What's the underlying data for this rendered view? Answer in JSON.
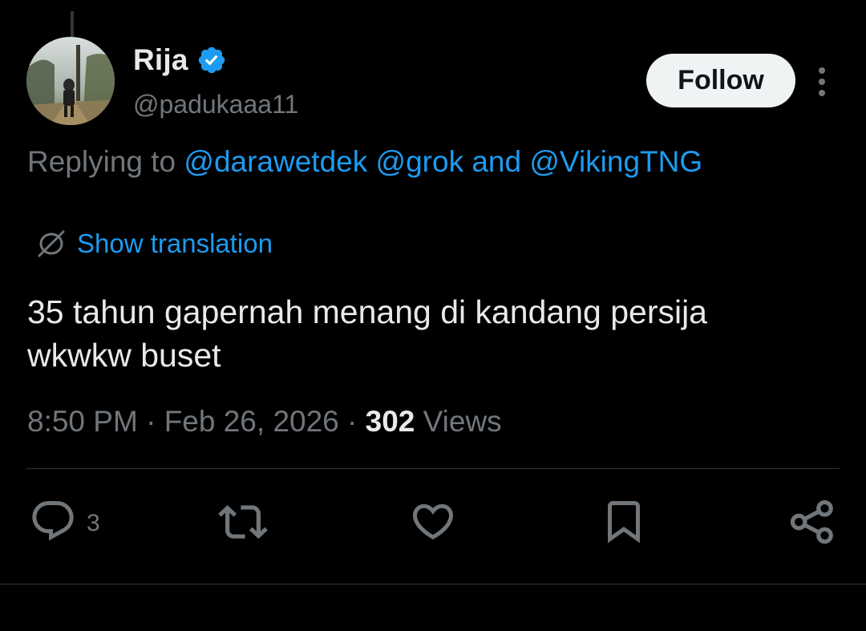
{
  "author": {
    "display_name": "Rija",
    "handle": "@padukaaa11",
    "verified": true
  },
  "follow_label": "Follow",
  "replying": {
    "prefix": "Replying to",
    "mentions": [
      "@darawetdek",
      "@grok"
    ],
    "and_word": "and",
    "last_mention": "@VikingTNG"
  },
  "translation_label": "Show translation",
  "tweet": {
    "text_line1": "35 tahun gapernah menang di kandang persija",
    "text_line2": "wkwkw buset",
    "time": "8:50 PM",
    "date": "Feb 26, 2026",
    "views_count": "302",
    "views_label": "Views"
  },
  "actions": {
    "reply_count": "3"
  },
  "colors": {
    "background": "#000000",
    "text_primary": "#e7e9ea",
    "text_secondary": "#71767b",
    "accent": "#1d9bf0",
    "divider": "#2f3336"
  },
  "icons": [
    "verified-badge-icon",
    "more-icon",
    "translate-icon",
    "reply-icon",
    "repost-icon",
    "like-icon",
    "bookmark-icon",
    "share-icon"
  ]
}
